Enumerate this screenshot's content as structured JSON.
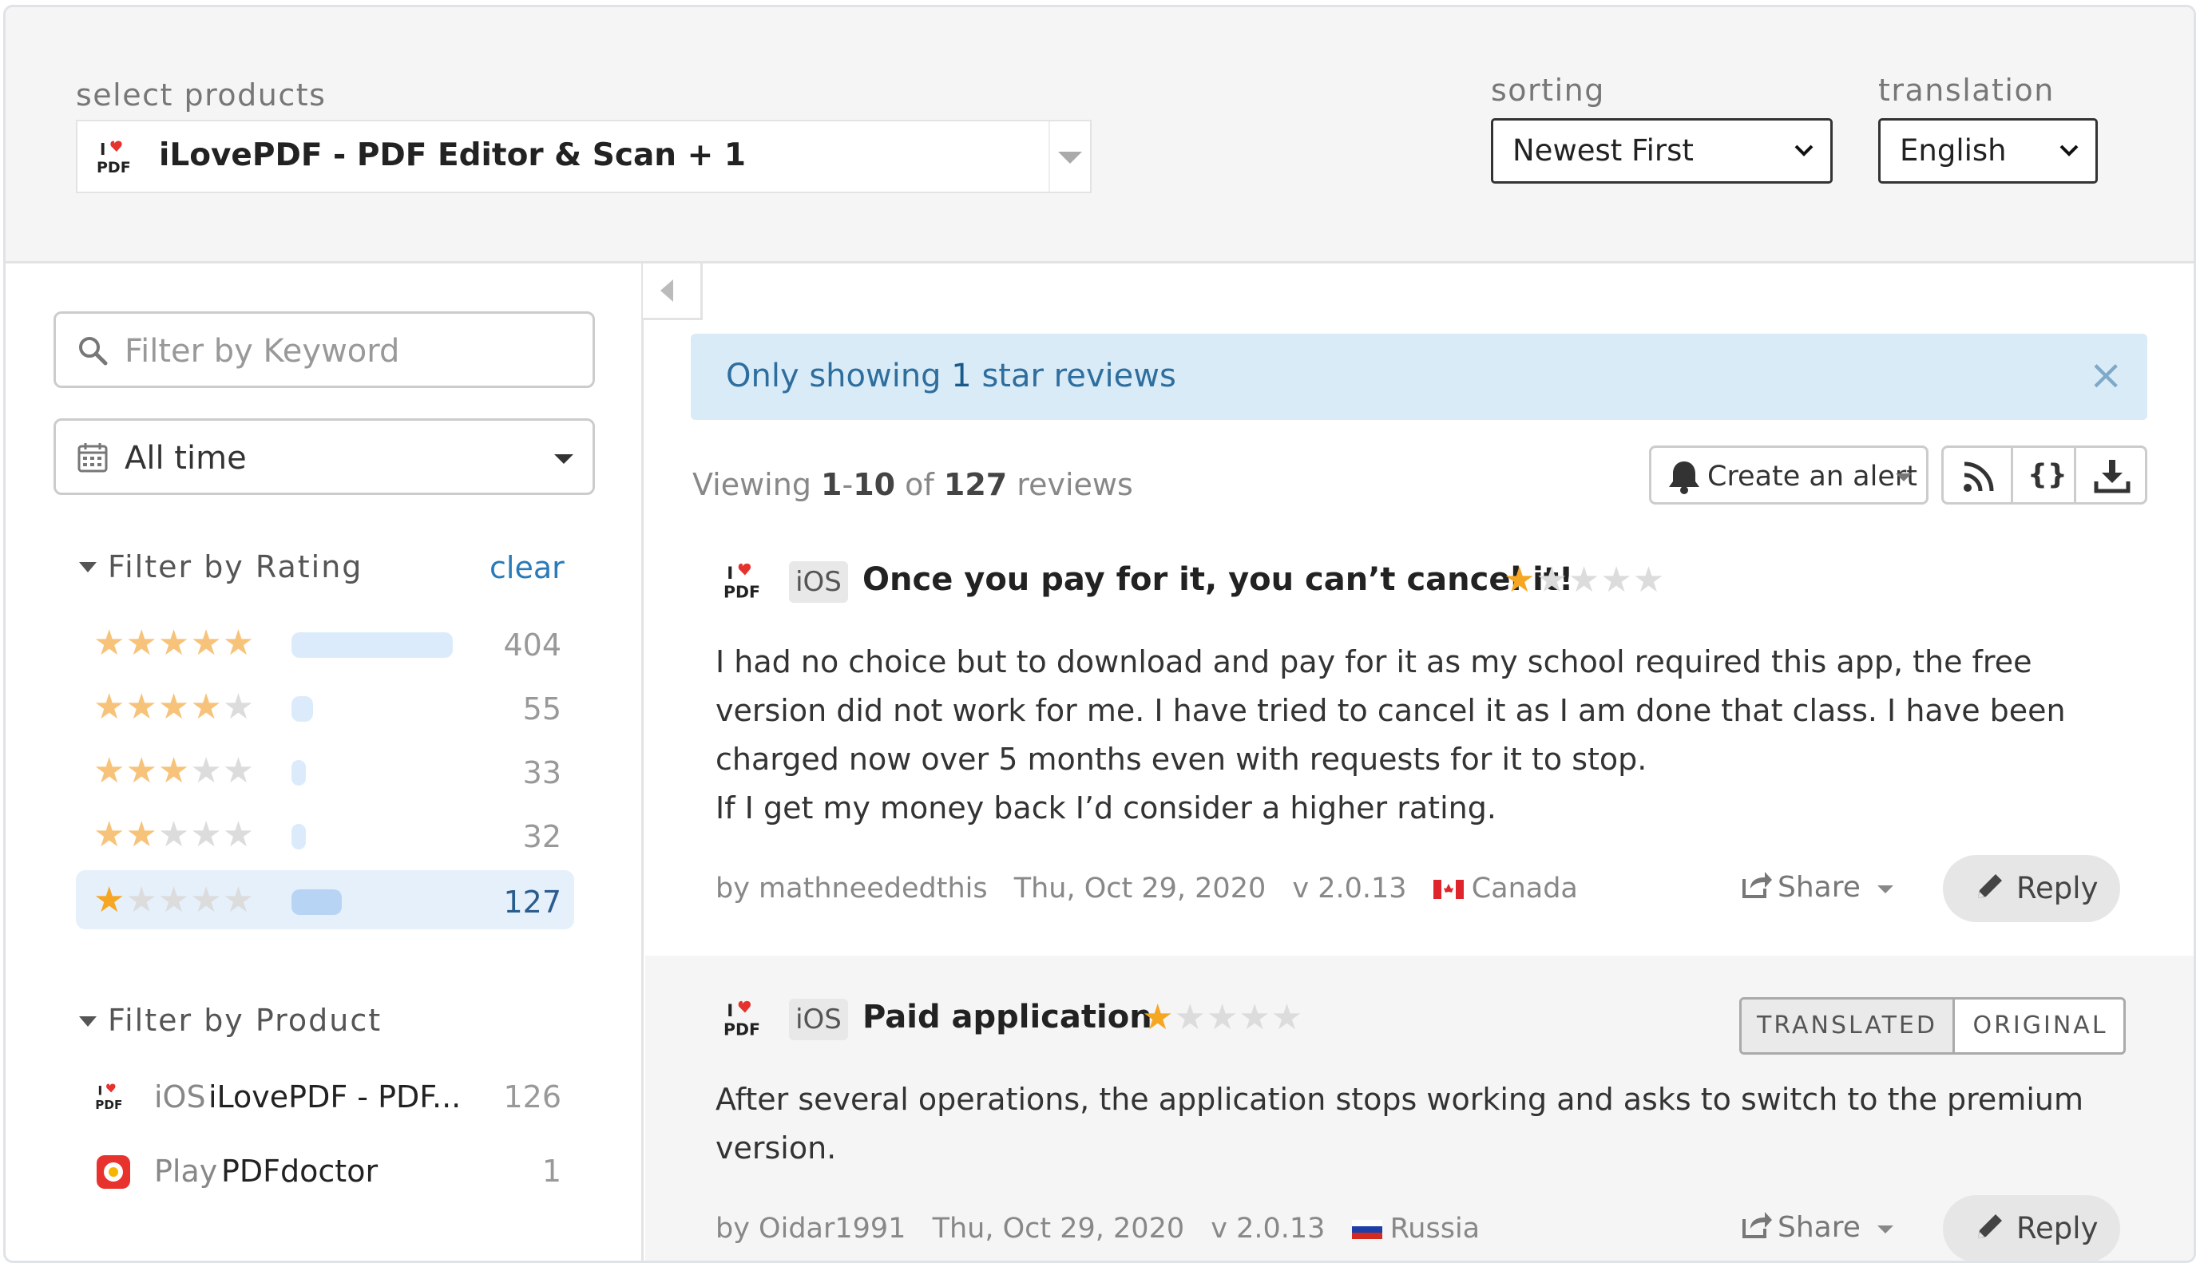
{
  "header": {
    "select_products_label": "select products",
    "product_selected": "iLovePDF - PDF Editor & Scan + 1",
    "sorting_label": "sorting",
    "sorting_value": "Newest First",
    "translation_label": "translation",
    "translation_value": "English"
  },
  "sidebar": {
    "keyword_placeholder": "Filter by Keyword",
    "time_filter": "All time",
    "rating_title": "Filter by Rating",
    "clear_label": "clear",
    "ratings": [
      {
        "stars": 5,
        "count": "404",
        "fraction": 1.0
      },
      {
        "stars": 4,
        "count": "55",
        "fraction": 0.136
      },
      {
        "stars": 3,
        "count": "33",
        "fraction": 0.082
      },
      {
        "stars": 2,
        "count": "32",
        "fraction": 0.079
      },
      {
        "stars": 1,
        "count": "127",
        "fraction": 0.314,
        "active": true
      }
    ],
    "product_title": "Filter by Product",
    "products": [
      {
        "platform": "iOS",
        "name": "iLovePDF - PDF...",
        "count": "126"
      },
      {
        "platform": "Play",
        "name": "PDFdoctor",
        "count": "1"
      }
    ]
  },
  "main": {
    "banner_prefix": "Only showing ",
    "banner_number": "1",
    "banner_suffix": " star reviews",
    "viewing_prefix": "Viewing ",
    "viewing_range_start": "1",
    "viewing_range_dash": "-",
    "viewing_range_end": "10",
    "viewing_of": " of ",
    "viewing_total": "127",
    "viewing_suffix": " reviews",
    "create_alert_label": "Create an alert",
    "json_label": "{}",
    "reviews": [
      {
        "platform": "iOS",
        "title": "Once you pay for it, you can’t cancel it!",
        "rating": 1,
        "body": [
          "I had no choice but to download and pay for it as my school required this app, the free",
          "version did not work for me. I have tried to cancel it as I am done that class. I have been",
          "charged now over 5 months even with requests for it to stop.",
          "If I get my money back I’d consider a higher rating."
        ],
        "author": "by mathneededthis",
        "date": "Thu, Oct 29, 2020",
        "version": "v 2.0.13",
        "country": "Canada",
        "share_label": "Share",
        "reply_label": "Reply"
      },
      {
        "platform": "iOS",
        "title": "Paid application",
        "rating": 1,
        "body": [
          "After several operations, the application stops working and asks to switch to the premium",
          "version."
        ],
        "author": "by Oidar1991",
        "date": "Thu, Oct 29, 2020",
        "version": "v 2.0.13",
        "country": "Russia",
        "share_label": "Share",
        "reply_label": "Reply",
        "translated_label": "TRANSLATED",
        "original_label": "ORIGINAL"
      }
    ]
  },
  "colors": {
    "accent_blue": "#2a7ab8",
    "banner_bg": "#d9ebf7",
    "star_gold": "#f5a623",
    "star_light": "#f7c37a"
  }
}
